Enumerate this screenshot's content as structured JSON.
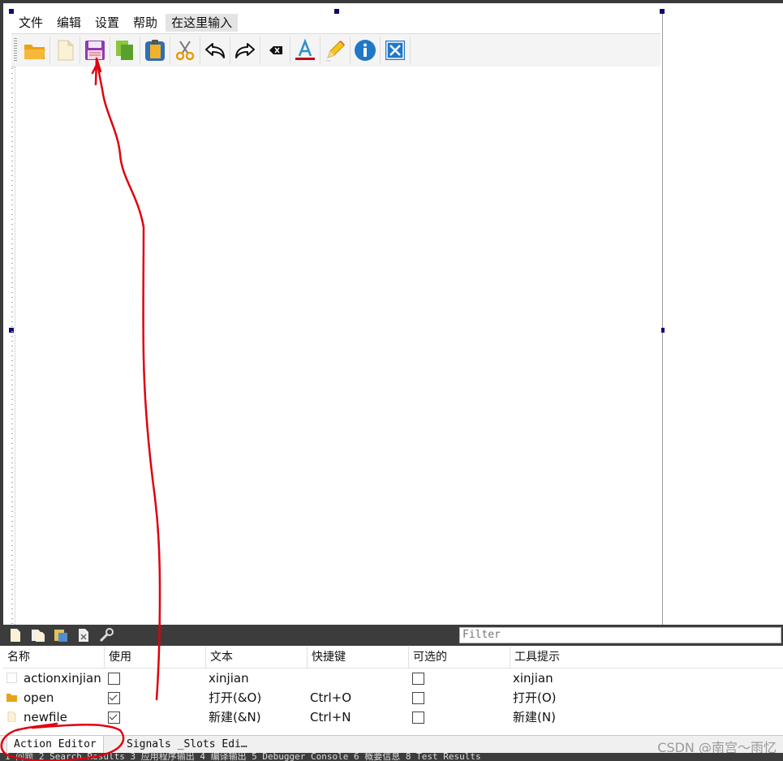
{
  "menubar": {
    "items": [
      "文件",
      "编辑",
      "设置",
      "帮助"
    ],
    "type_here": "在这里输入"
  },
  "toolbar": {
    "buttons": [
      {
        "name": "open-folder-icon"
      },
      {
        "name": "new-file-icon"
      },
      {
        "name": "save-icon"
      },
      {
        "name": "copy-icon"
      },
      {
        "name": "paste-icon"
      },
      {
        "name": "cut-icon"
      },
      {
        "name": "undo-icon"
      },
      {
        "name": "redo-icon"
      },
      {
        "name": "delete-icon"
      },
      {
        "name": "font-color-icon"
      },
      {
        "name": "pencil-icon"
      },
      {
        "name": "info-icon"
      },
      {
        "name": "close-icon"
      }
    ]
  },
  "action_editor": {
    "filter_placeholder": "Filter",
    "columns": [
      "名称",
      "使用",
      "文本",
      "快捷键",
      "可选的",
      "工具提示"
    ],
    "rows": [
      {
        "name": "actionxinjian",
        "used": false,
        "text": "xinjian",
        "shortcut": "",
        "checkable": false,
        "tooltip": "xinjian",
        "icon": "blank"
      },
      {
        "name": "open",
        "used": true,
        "text": "打开(&O)",
        "shortcut": "Ctrl+O",
        "checkable": false,
        "tooltip": "打开(O)",
        "icon": "folder"
      },
      {
        "name": "newfile",
        "used": true,
        "text": "新建(&N)",
        "shortcut": "Ctrl+N",
        "checkable": false,
        "tooltip": "新建(N)",
        "icon": "file"
      }
    ]
  },
  "tabs": {
    "action_editor": "Action Editor",
    "signals_slots": "Signals _Slots Edi…"
  },
  "statusbar": {
    "text": "1 问题  2 Search Results  3 应用程序输出  4 编译输出  5 Debugger Console  6 概要信息  8 Test Results"
  },
  "watermark": "CSDN @南宫～雨忆",
  "colors": {
    "annotation": "#e0000f",
    "dark_bar": "#3c3c3c",
    "selection_handle": "#0a0a6e"
  }
}
